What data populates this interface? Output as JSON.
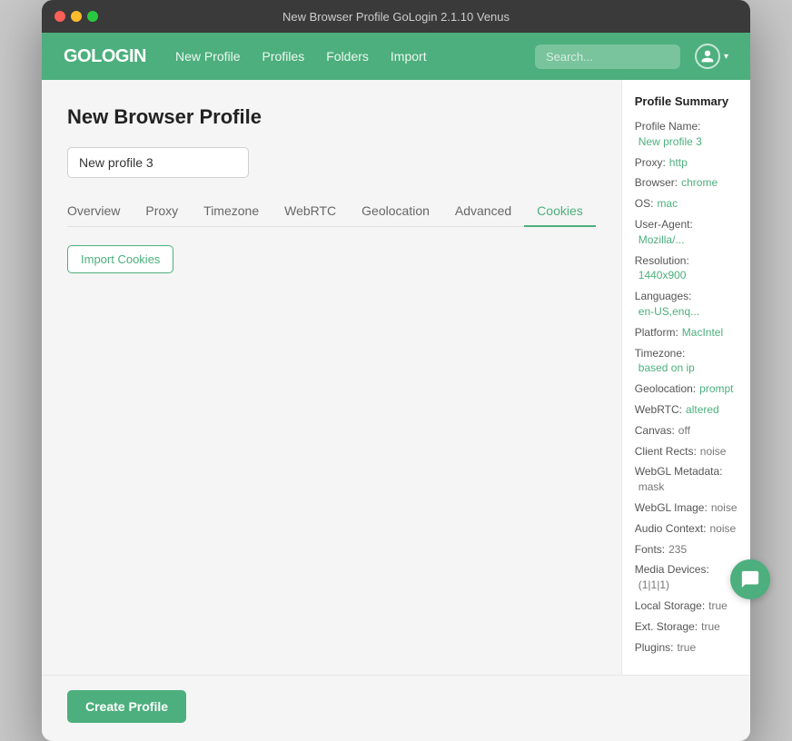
{
  "window": {
    "title": "New Browser Profile GoLogin 2.1.10 Venus"
  },
  "nav": {
    "logo": "GOLOGIN",
    "links": [
      "New Profile",
      "Profiles",
      "Folders",
      "Import"
    ],
    "search_placeholder": "Search...",
    "user_chevron": "▾"
  },
  "main": {
    "page_title": "New Browser Profile",
    "profile_name_placeholder": "New profile 3",
    "profile_name_value": "New profile 3",
    "tabs": [
      {
        "label": "Overview",
        "active": false
      },
      {
        "label": "Proxy",
        "active": false
      },
      {
        "label": "Timezone",
        "active": false
      },
      {
        "label": "WebRTC",
        "active": false
      },
      {
        "label": "Geolocation",
        "active": false
      },
      {
        "label": "Advanced",
        "active": false
      },
      {
        "label": "Cookies",
        "active": true
      }
    ],
    "import_cookies_label": "Import Cookies",
    "create_profile_label": "Create Profile"
  },
  "summary": {
    "title": "Profile Summary",
    "rows": [
      {
        "label": "Profile Name:",
        "value": "New profile 3",
        "green": true
      },
      {
        "label": "Proxy:",
        "value": "http",
        "green": true
      },
      {
        "label": "Browser:",
        "value": "chrome",
        "green": true
      },
      {
        "label": "OS:",
        "value": "mac",
        "green": true
      },
      {
        "label": "User-Agent:",
        "value": "Mozilla/...",
        "green": true
      },
      {
        "label": "Resolution:",
        "value": "1440x900",
        "green": true
      },
      {
        "label": "Languages:",
        "value": "en-US,enq...",
        "green": true
      },
      {
        "label": "Platform:",
        "value": "MacIntel",
        "green": true
      },
      {
        "label": "Timezone:",
        "value": "based on ip",
        "green": true
      },
      {
        "label": "Geolocation:",
        "value": "prompt",
        "green": true
      },
      {
        "label": "WebRTC:",
        "value": "altered",
        "green": true
      },
      {
        "label": "Canvas:",
        "value": "off",
        "green": false
      },
      {
        "label": "Client Rects:",
        "value": "noise",
        "green": false
      },
      {
        "label": "WebGL Metadata:",
        "value": "mask",
        "green": false
      },
      {
        "label": "WebGL Image:",
        "value": "noise",
        "green": false
      },
      {
        "label": "Audio Context:",
        "value": "noise",
        "green": false
      },
      {
        "label": "Fonts:",
        "value": "235",
        "green": false
      },
      {
        "label": "Media Devices:",
        "value": "(1|1|1)",
        "green": false
      },
      {
        "label": "Local Storage:",
        "value": "true",
        "green": false
      },
      {
        "label": "Ext. Storage:",
        "value": "true",
        "green": false
      },
      {
        "label": "Plugins:",
        "value": "true",
        "green": false
      }
    ]
  }
}
